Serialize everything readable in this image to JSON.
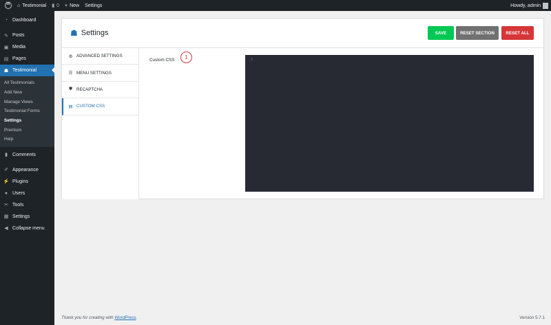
{
  "admin_bar": {
    "site_name": "Testimonial",
    "comments_count": "0",
    "new_label": "New",
    "settings_label": "Settings",
    "greeting": "Howdy, admin"
  },
  "sidebar": {
    "items_top": [
      {
        "label": "Dashboard",
        "icon": "dashboard-icon"
      },
      {
        "label": "Posts",
        "icon": "pin-icon"
      },
      {
        "label": "Media",
        "icon": "media-icon"
      },
      {
        "label": "Pages",
        "icon": "page-icon"
      },
      {
        "label": "Testimonial",
        "icon": "users-icon"
      }
    ],
    "submenu": [
      "All Testimonials",
      "Add New",
      "Manage Views",
      "Testimonial Forms",
      "Settings",
      "Premium",
      "Help"
    ],
    "items_bottom": [
      {
        "label": "Comments",
        "icon": "comment-icon"
      },
      {
        "label": "Appearance",
        "icon": "brush-icon"
      },
      {
        "label": "Plugins",
        "icon": "plugin-icon"
      },
      {
        "label": "Users",
        "icon": "user-icon"
      },
      {
        "label": "Tools",
        "icon": "wrench-icon"
      },
      {
        "label": "Settings",
        "icon": "settings-icon"
      },
      {
        "label": "Collapse menu",
        "icon": "collapse-icon"
      }
    ]
  },
  "panel": {
    "title": "Settings",
    "buttons": {
      "save": "SAVE",
      "reset_section": "RESET SECTION",
      "reset_all": "RESET ALL"
    },
    "tabs": [
      {
        "label": "ADVANCED SETTINGS",
        "icon": "gears-icon"
      },
      {
        "label": "MENU SETTINGS",
        "icon": "menu-icon"
      },
      {
        "label": "RECAPTCHA",
        "icon": "shield-icon"
      },
      {
        "label": "CUSTOM CSS",
        "icon": "css-icon"
      }
    ],
    "field_label": "Custom CSS",
    "step_badge": "1",
    "editor_line_number": "1"
  },
  "footer": {
    "thanks_prefix": "Thank you for creating with ",
    "thanks_link": "WordPress",
    "thanks_suffix": ".",
    "version": "Version 5.7.1"
  },
  "colors": {
    "accent": "#2271b1",
    "save": "#00c853",
    "reset_section": "#707070",
    "reset_all": "#d63638",
    "editor_bg": "#272a33",
    "sidebar_bg": "#1d2327"
  }
}
